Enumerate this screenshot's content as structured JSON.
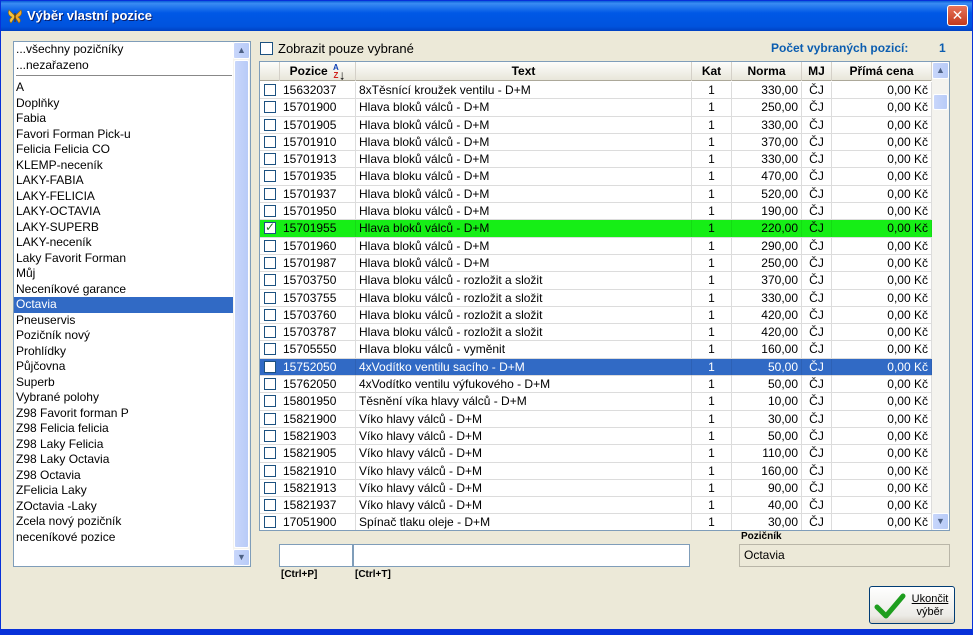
{
  "window": {
    "title": "Výběr vlastní pozice",
    "close_label": "✕"
  },
  "left_list": {
    "top_items": [
      "...všechny pozičníky",
      "...nezařazeno"
    ],
    "items": [
      "A",
      "Doplňky",
      "Fabia",
      "Favori Forman Pick-u",
      "Felicia Felicia CO",
      "KLEMP-neceník",
      "LAKY-FABIA",
      "LAKY-FELICIA",
      "LAKY-OCTAVIA",
      "LAKY-SUPERB",
      "LAKY-neceník",
      "Laky Favorit Forman",
      "Můj",
      "Neceníkové garance",
      "Octavia",
      "Pneuservis",
      "Pozičník nový",
      "Prohlídky",
      "Půjčovna",
      "Superb",
      "Vybrané polohy",
      "Z98 Favorit forman P",
      "Z98 Felicia felicia",
      "Z98 Laky Felicia",
      "Z98 Laky Octavia",
      "Z98 Octavia",
      "ZFelicia Laky",
      "ZOctavia -Laky",
      "Zcela nový pozičník",
      "neceníkové pozice"
    ],
    "selected_index": 14
  },
  "filter": {
    "show_selected_label": "Zobrazit pouze vybrané",
    "checked": false
  },
  "count": {
    "label": "Počet vybraných pozicí:",
    "value": "1"
  },
  "grid": {
    "columns": [
      {
        "key": "pozice",
        "label": "Pozice"
      },
      {
        "key": "text",
        "label": "Text"
      },
      {
        "key": "kat",
        "label": "Kat"
      },
      {
        "key": "norma",
        "label": "Norma"
      },
      {
        "key": "mj",
        "label": "MJ"
      },
      {
        "key": "prima_cena",
        "label": "Přímá cena"
      }
    ],
    "rows": [
      {
        "checked": false,
        "pozice": "15632037",
        "text": "8xTěsnící kroužek ventilu - D+M",
        "kat": "1",
        "norma": "330,00",
        "mj": "ČJ",
        "cena": "0,00 Kč",
        "state": ""
      },
      {
        "checked": false,
        "pozice": "15701900",
        "text": "Hlava bloků válců - D+M",
        "kat": "1",
        "norma": "250,00",
        "mj": "ČJ",
        "cena": "0,00 Kč",
        "state": ""
      },
      {
        "checked": false,
        "pozice": "15701905",
        "text": "Hlava bloků válců - D+M",
        "kat": "1",
        "norma": "330,00",
        "mj": "ČJ",
        "cena": "0,00 Kč",
        "state": ""
      },
      {
        "checked": false,
        "pozice": "15701910",
        "text": "Hlava bloků válců - D+M",
        "kat": "1",
        "norma": "370,00",
        "mj": "ČJ",
        "cena": "0,00 Kč",
        "state": ""
      },
      {
        "checked": false,
        "pozice": "15701913",
        "text": "Hlava bloků válců - D+M",
        "kat": "1",
        "norma": "330,00",
        "mj": "ČJ",
        "cena": "0,00 Kč",
        "state": ""
      },
      {
        "checked": false,
        "pozice": "15701935",
        "text": "Hlava bloku válců - D+M",
        "kat": "1",
        "norma": "470,00",
        "mj": "ČJ",
        "cena": "0,00 Kč",
        "state": ""
      },
      {
        "checked": false,
        "pozice": "15701937",
        "text": "Hlava bloků válců - D+M",
        "kat": "1",
        "norma": "520,00",
        "mj": "ČJ",
        "cena": "0,00 Kč",
        "state": ""
      },
      {
        "checked": false,
        "pozice": "15701950",
        "text": "Hlava bloku válců - D+M",
        "kat": "1",
        "norma": "190,00",
        "mj": "ČJ",
        "cena": "0,00 Kč",
        "state": ""
      },
      {
        "checked": true,
        "pozice": "15701955",
        "text": "Hlava bloků válců - D+M",
        "kat": "1",
        "norma": "220,00",
        "mj": "ČJ",
        "cena": "0,00 Kč",
        "state": "green"
      },
      {
        "checked": false,
        "pozice": "15701960",
        "text": "Hlava bloků válců - D+M",
        "kat": "1",
        "norma": "290,00",
        "mj": "ČJ",
        "cena": "0,00 Kč",
        "state": ""
      },
      {
        "checked": false,
        "pozice": "15701987",
        "text": "Hlava bloků válců - D+M",
        "kat": "1",
        "norma": "250,00",
        "mj": "ČJ",
        "cena": "0,00 Kč",
        "state": ""
      },
      {
        "checked": false,
        "pozice": "15703750",
        "text": "Hlava bloku válců - rozložit a složit",
        "kat": "1",
        "norma": "370,00",
        "mj": "ČJ",
        "cena": "0,00 Kč",
        "state": ""
      },
      {
        "checked": false,
        "pozice": "15703755",
        "text": "Hlava bloku válců - rozložit a složit",
        "kat": "1",
        "norma": "330,00",
        "mj": "ČJ",
        "cena": "0,00 Kč",
        "state": ""
      },
      {
        "checked": false,
        "pozice": "15703760",
        "text": "Hlava bloku válců - rozložit a složit",
        "kat": "1",
        "norma": "420,00",
        "mj": "ČJ",
        "cena": "0,00 Kč",
        "state": ""
      },
      {
        "checked": false,
        "pozice": "15703787",
        "text": "Hlava bloku válců - rozložit a složit",
        "kat": "1",
        "norma": "420,00",
        "mj": "ČJ",
        "cena": "0,00 Kč",
        "state": ""
      },
      {
        "checked": false,
        "pozice": "15705550",
        "text": "Hlava bloku válců - vyměnit",
        "kat": "1",
        "norma": "160,00",
        "mj": "ČJ",
        "cena": "0,00 Kč",
        "state": ""
      },
      {
        "checked": false,
        "pozice": "15752050",
        "text": "4xVodítko ventilu sacího - D+M",
        "kat": "1",
        "norma": "50,00",
        "mj": "ČJ",
        "cena": "0,00 Kč",
        "state": "blue"
      },
      {
        "checked": false,
        "pozice": "15762050",
        "text": "4xVodítko ventilu výfukového - D+M",
        "kat": "1",
        "norma": "50,00",
        "mj": "ČJ",
        "cena": "0,00 Kč",
        "state": ""
      },
      {
        "checked": false,
        "pozice": "15801950",
        "text": "Těsnění víka hlavy válců - D+M",
        "kat": "1",
        "norma": "10,00",
        "mj": "ČJ",
        "cena": "0,00 Kč",
        "state": ""
      },
      {
        "checked": false,
        "pozice": "15821900",
        "text": "Víko hlavy válců - D+M",
        "kat": "1",
        "norma": "30,00",
        "mj": "ČJ",
        "cena": "0,00 Kč",
        "state": ""
      },
      {
        "checked": false,
        "pozice": "15821903",
        "text": "Víko hlavy válců - D+M",
        "kat": "1",
        "norma": "50,00",
        "mj": "ČJ",
        "cena": "0,00 Kč",
        "state": ""
      },
      {
        "checked": false,
        "pozice": "15821905",
        "text": "Víko hlavy válců - D+M",
        "kat": "1",
        "norma": "110,00",
        "mj": "ČJ",
        "cena": "0,00 Kč",
        "state": ""
      },
      {
        "checked": false,
        "pozice": "15821910",
        "text": "Víko hlavy válců - D+M",
        "kat": "1",
        "norma": "160,00",
        "mj": "ČJ",
        "cena": "0,00 Kč",
        "state": ""
      },
      {
        "checked": false,
        "pozice": "15821913",
        "text": "Víko hlavy válců - D+M",
        "kat": "1",
        "norma": "90,00",
        "mj": "ČJ",
        "cena": "0,00 Kč",
        "state": ""
      },
      {
        "checked": false,
        "pozice": "15821937",
        "text": "Víko hlavy válců - D+M",
        "kat": "1",
        "norma": "40,00",
        "mj": "ČJ",
        "cena": "0,00 Kč",
        "state": ""
      },
      {
        "checked": false,
        "pozice": "17051900",
        "text": "Spínač tlaku oleje - D+M",
        "kat": "1",
        "norma": "30,00",
        "mj": "ČJ",
        "cena": "0,00 Kč",
        "state": ""
      }
    ]
  },
  "search": {
    "pozice_value": "",
    "pozice_hint": "[Ctrl+P]",
    "text_value": "",
    "text_hint": "[Ctrl+T]"
  },
  "poznicnik": {
    "label": "Pozičník",
    "value": "Octavia"
  },
  "end_button": {
    "line1": "Ukončit",
    "line2": "výběr"
  },
  "colors": {
    "highlight_green": "#16ee16",
    "selection_blue": "#316ac5",
    "accent_text": "#0b5db0"
  },
  "icons": {
    "app": "butterfly-icon",
    "sort": "sort-az-icon",
    "ok": "checkmark-icon"
  }
}
